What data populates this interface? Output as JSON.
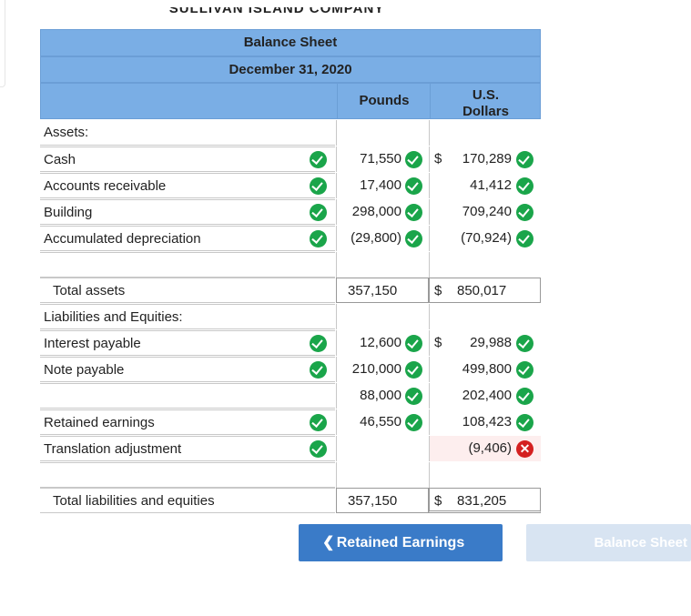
{
  "company_name_partial": "SULLIVAN ISLAND COMPANY",
  "title": "Balance Sheet",
  "date": "December 31, 2020",
  "columns": {
    "pounds": "Pounds",
    "usd_line1": "U.S.",
    "usd_line2": "Dollars"
  },
  "currency_symbol": "$",
  "rows": [
    {
      "label": "Assets:"
    },
    {
      "label": "Cash",
      "pounds": "71,550",
      "usd": "170,289"
    },
    {
      "label": "Accounts receivable",
      "pounds": "17,400",
      "usd": "41,412"
    },
    {
      "label": "Building",
      "pounds": "298,000",
      "usd": "709,240"
    },
    {
      "label": "Accumulated depreciation",
      "pounds": "(29,800)",
      "usd": "(70,924)"
    },
    {
      "label": "Total assets",
      "pounds": "357,150",
      "usd": "850,017"
    },
    {
      "label": "Liabilities and Equities:"
    },
    {
      "label": "Interest payable",
      "pounds": "12,600",
      "usd": "29,988"
    },
    {
      "label": "Note payable",
      "pounds": "210,000",
      "usd": "499,800"
    },
    {
      "label": "",
      "pounds": "88,000",
      "usd": "202,400"
    },
    {
      "label": "Retained earnings",
      "pounds": "46,550",
      "usd": "108,423"
    },
    {
      "label": "Translation adjustment",
      "pounds": "",
      "usd": "(9,406)"
    },
    {
      "label": "Total liabilities and equities",
      "pounds": "357,150",
      "usd": "831,205"
    }
  ],
  "buttons": {
    "prev": "Retained Earnings",
    "next": "Balance Sheet"
  },
  "colors": {
    "header": "#7aaee5",
    "check": "#1aa54a",
    "error": "#d42020",
    "prev_button": "#3a7bc8",
    "next_button": "#d8e4f2"
  }
}
